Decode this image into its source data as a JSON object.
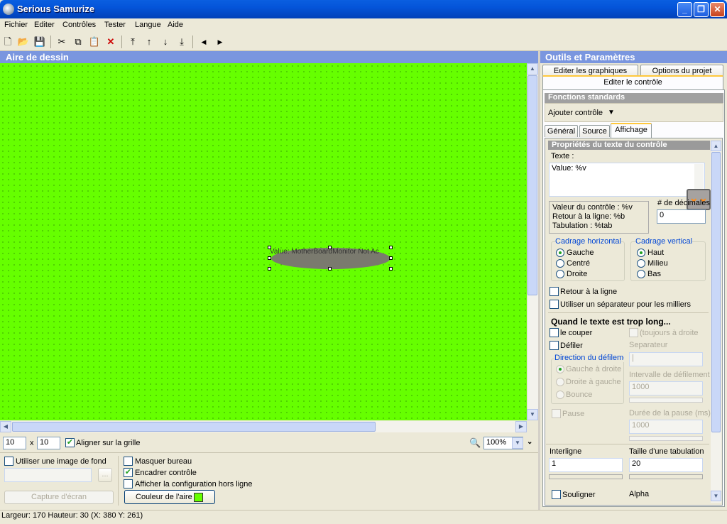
{
  "window": {
    "title": "Serious Samurize",
    "min": "_",
    "max": "❐",
    "close": "✕"
  },
  "menu": [
    "Fichier",
    "Editer",
    "Contrôles",
    "Tester",
    "Langue",
    "Aide"
  ],
  "toolbar_icons": [
    "new-icon",
    "open-icon",
    "save-icon",
    "cut-icon",
    "copy-icon",
    "paste-icon",
    "delete-icon",
    "bring-to-front-icon",
    "move-up-icon",
    "move-down-icon",
    "send-to-back-icon",
    "arrow-left-icon",
    "arrow-right-icon"
  ],
  "drawing": {
    "header": "Aire de dessin",
    "background_color": "#66ff00",
    "control_text": "Value: MotherBoardMonitor Not Ac"
  },
  "grid": {
    "x": "10",
    "sep": "x",
    "y": "10",
    "align_label": "Aligner sur la grille",
    "align_checked": true
  },
  "zoom": {
    "value": "100%"
  },
  "bottom": {
    "use_bg_image": "Utiliser une image de fond",
    "browse": "...",
    "screenshot": "Capture d'écran",
    "hide_desktop": "Masquer bureau",
    "frame_control": "Encadrer contrôle",
    "frame_checked": true,
    "show_offline": "Afficher la configuration hors ligne",
    "area_color": "Couleur de l'aire",
    "area_color_swatch": "#66ff00"
  },
  "status": "Largeur: 170  Hauteur: 30  (X: 380  Y: 261)",
  "right": {
    "header": "Outils et Paramètres",
    "tabs": [
      "Editer les graphiques",
      "Options du projet",
      "Editer le contrôle"
    ],
    "std_functions": "Fonctions standards",
    "add_control": "Ajouter contrôle",
    "sub_tabs": [
      "Général",
      "Source",
      "Affichage"
    ],
    "props_title": "Propriétés du texte du contrôle",
    "text_label": "Texte :",
    "text_value": "Value: %v",
    "legend": [
      "Valeur du contrôle : %v",
      "Retour à la ligne: %b",
      "Tabulation : %tab"
    ],
    "decimals_label": "# de décimales",
    "decimals_value": "0",
    "h_align": {
      "title": "Cadrage horizontal",
      "options": [
        "Gauche",
        "Centré",
        "Droite"
      ]
    },
    "v_align": {
      "title": "Cadrage vertical",
      "options": [
        "Haut",
        "Milieu",
        "Bas"
      ]
    },
    "wrap": "Retour à la ligne",
    "thousands": "Utiliser un séparateur pour les milliers",
    "too_long": "Quand le texte est trop long...",
    "cut": "le couper",
    "always_right": "(toujours à droite",
    "scroll": "Défiler",
    "separator_label": "Separateur",
    "separator_value": "|",
    "scroll_dir": "Direction du défileme",
    "dir_options": [
      "Gauche à droite",
      "Droite à gauche",
      "Bounce"
    ],
    "interval_label": "Intervalle de défilement",
    "interval_value": "1000",
    "pause": "Pause",
    "pause_dur_label": "Durée de la pause (ms)",
    "pause_dur_value": "1000",
    "line_spacing_label": "Interligne",
    "line_spacing_value": "1",
    "tab_size_label": "Taille d'une tabulation",
    "tab_size_value": "20",
    "underline": "Souligner",
    "alpha": "Alpha"
  }
}
